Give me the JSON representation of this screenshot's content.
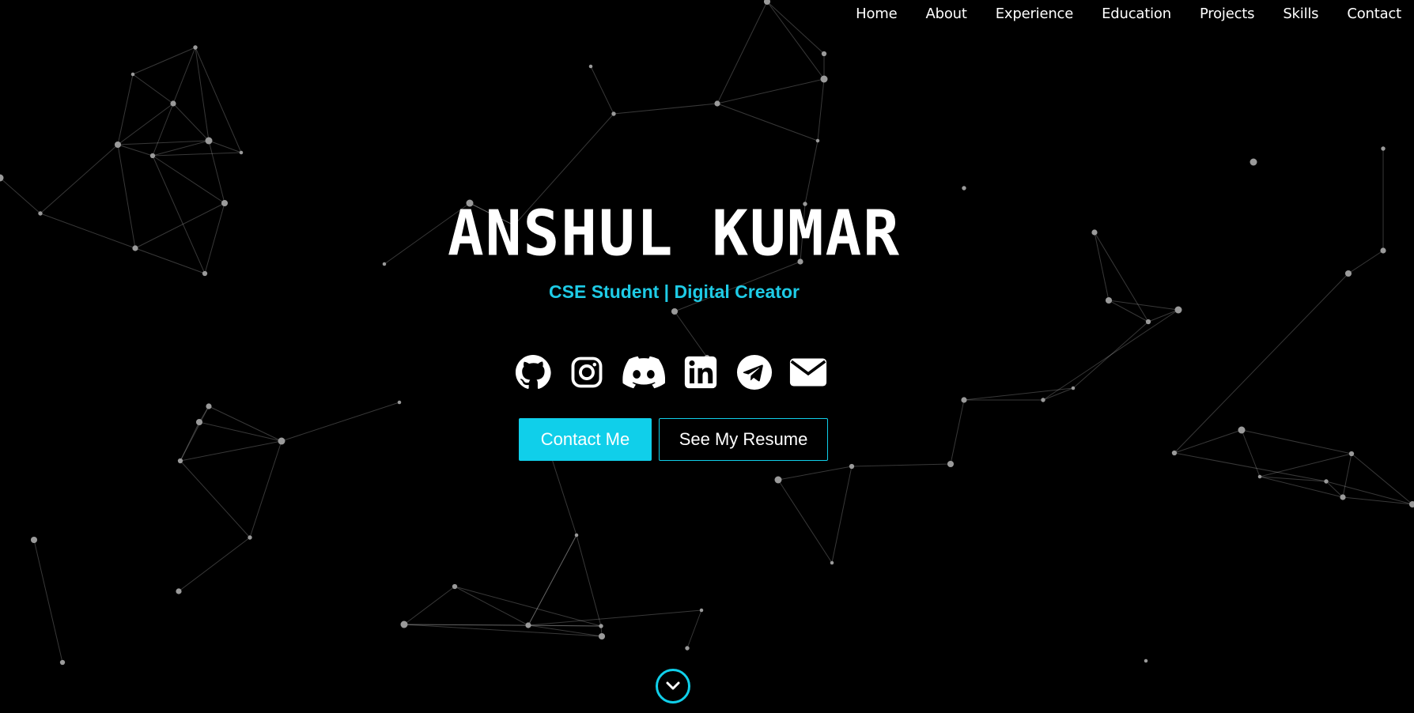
{
  "nav": {
    "items": [
      "Home",
      "About",
      "Experience",
      "Education",
      "Projects",
      "Skills",
      "Contact"
    ]
  },
  "hero": {
    "name": "ANSHUL KUMAR",
    "tagline": "CSE Student | Digital Creator"
  },
  "socials": [
    "github-icon",
    "instagram-icon",
    "discord-icon",
    "linkedin-icon",
    "telegram-icon",
    "email-icon"
  ],
  "buttons": {
    "contact": "Contact Me",
    "resume": "See My Resume"
  },
  "colors": {
    "background": "#000000",
    "accent": "#10cfea",
    "text": "#ffffff",
    "network": "#9a9a9a"
  },
  "icons": {
    "scroll_down": "chevron-down-icon"
  }
}
